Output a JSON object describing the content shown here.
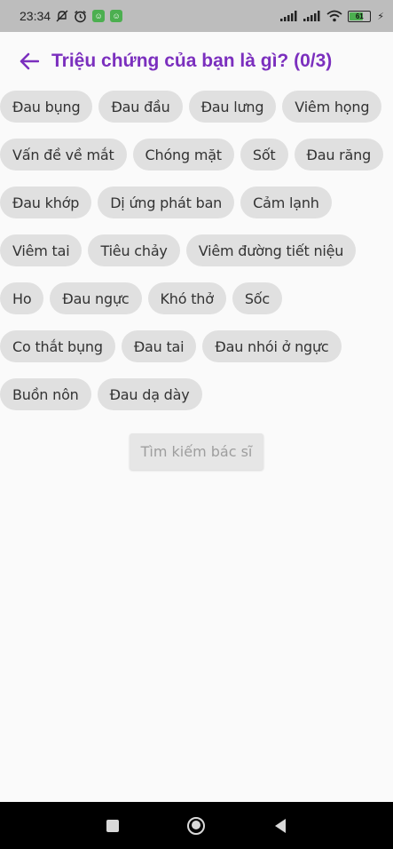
{
  "status_bar": {
    "time": "23:34",
    "battery": "61",
    "colors": {
      "background": "#bdbdbd",
      "battery_fill": "#4caf50"
    },
    "icons": [
      "mute-icon",
      "alarm-icon",
      "app-badge-icon",
      "app-badge-icon",
      "signal-icon",
      "signal-icon",
      "wifi-icon",
      "battery-icon"
    ]
  },
  "header": {
    "title": "Triệu chứng của bạn là gì? (0/3)",
    "back_icon": "arrow-left-icon",
    "accent_color": "#7b2fbe"
  },
  "symptoms": [
    "Đau bụng",
    "Đau đầu",
    "Đau lưng",
    "Viêm họng",
    "Vấn đề về mắt",
    "Chóng mặt",
    "Sốt",
    "Đau răng",
    "Đau khớp",
    "Dị ứng phát ban",
    "Cảm lạnh",
    "Viêm tai",
    "Tiêu chảy",
    "Viêm đường tiết niệu",
    "Ho",
    "Đau ngực",
    "Khó thở",
    "Sốc",
    "Co thắt bụng",
    "Đau tai",
    "Đau nhói ở ngực",
    "Buồn nôn",
    "Đau dạ dày"
  ],
  "search_button": {
    "label": "Tìm kiếm bác sĩ",
    "enabled": false
  },
  "nav_bar": {
    "icons": [
      "recents-square-icon",
      "home-circle-icon",
      "back-triangle-icon"
    ]
  }
}
